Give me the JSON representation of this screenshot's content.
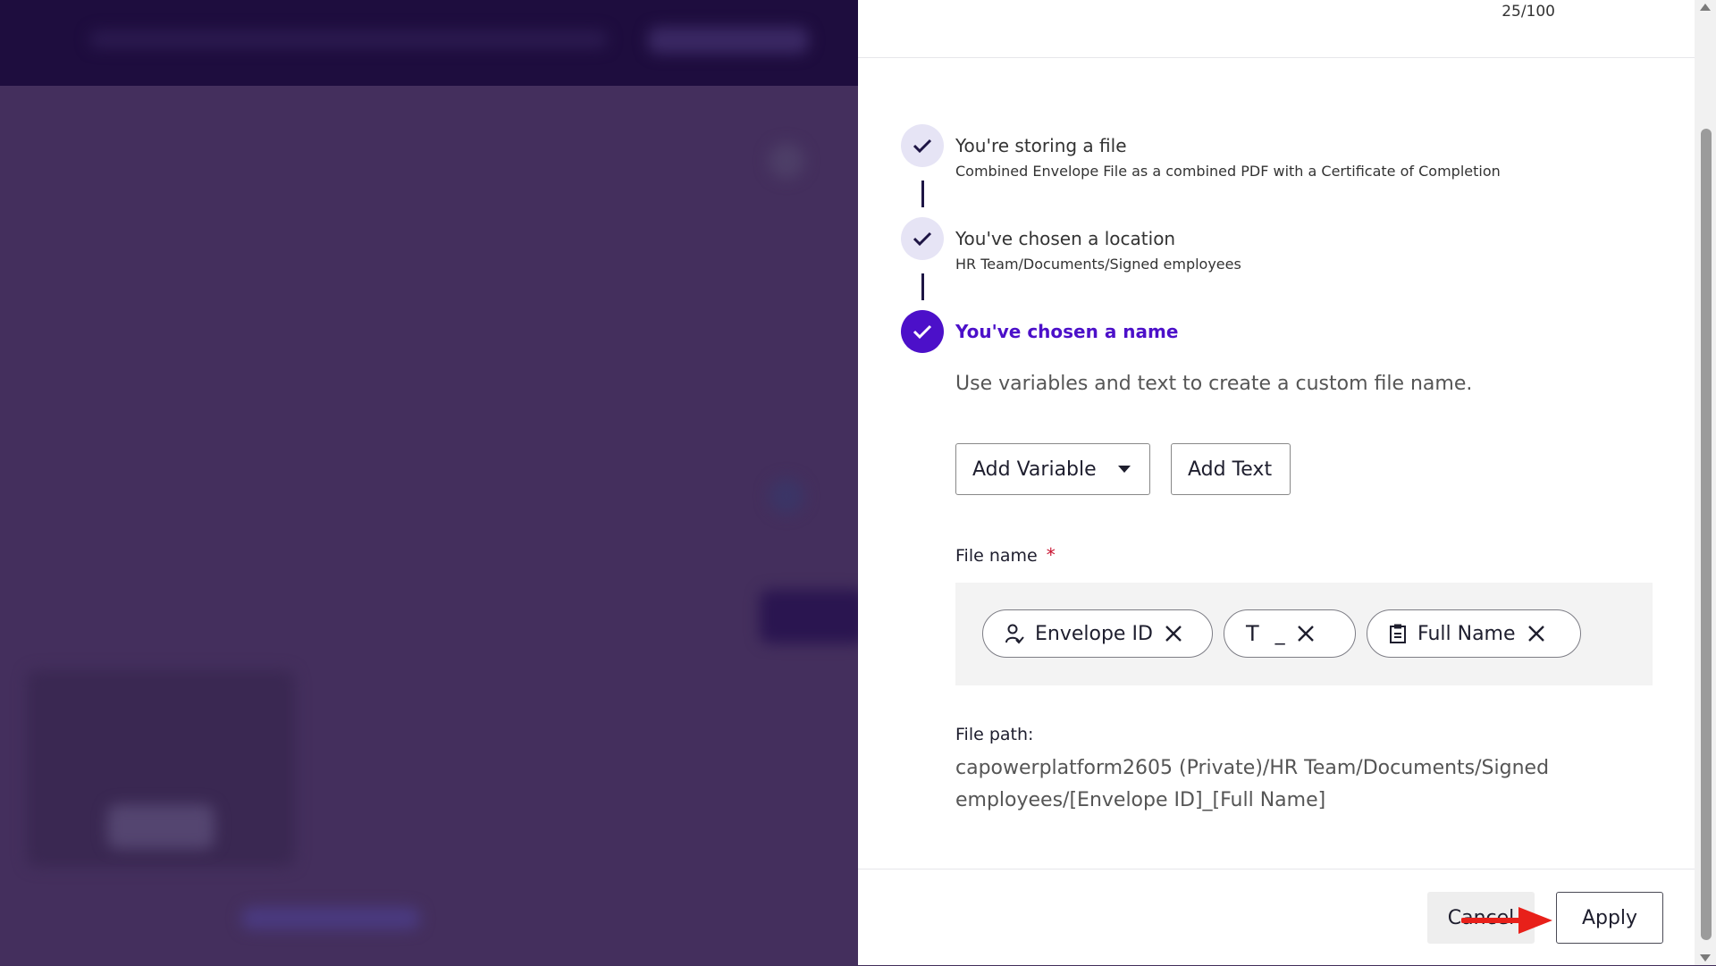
{
  "header": {
    "counter": "25/100"
  },
  "steps": [
    {
      "title": "You're storing a file",
      "subtitle": "Combined Envelope File as a combined PDF with a Certificate of Completion",
      "state": "done"
    },
    {
      "title": "You've chosen a location",
      "subtitle": "HR Team/Documents/Signed employees",
      "state": "done"
    },
    {
      "title": "You've chosen a name",
      "state": "active"
    }
  ],
  "naming": {
    "instructions": "Use variables and text to create a custom file name.",
    "add_variable_label": "Add Variable",
    "add_text_label": "Add Text",
    "file_name_label": "File name",
    "required_marker": "*",
    "chips": [
      {
        "label": "Envelope ID",
        "icon": "person-check-icon"
      },
      {
        "label": "_",
        "icon": "text-t-icon",
        "prefix": "T"
      },
      {
        "label": "Full Name",
        "icon": "clipboard-icon"
      }
    ],
    "file_path_label": "File path:",
    "file_path": "capowerplatform2605 (Private)/HR Team/Documents/Signed employees/[Envelope ID]_[Full Name]"
  },
  "footer": {
    "cancel_label": "Cancel",
    "apply_label": "Apply"
  },
  "colors": {
    "accent": "#4c10c9",
    "overlay": "#412e5a",
    "required": "#c8102e",
    "annotation_arrow": "#e8201a"
  }
}
